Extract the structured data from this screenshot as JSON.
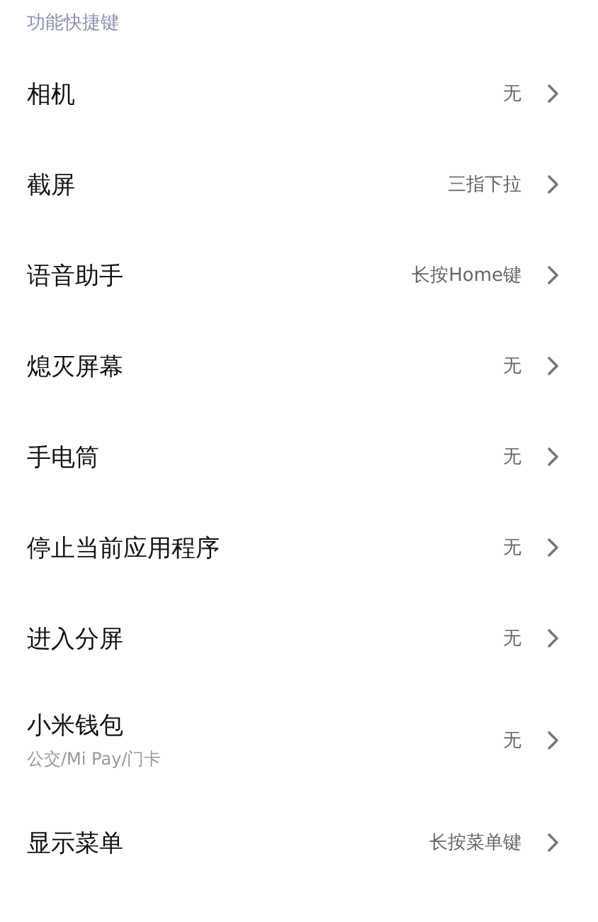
{
  "section_title": "功能快捷键",
  "items": [
    {
      "label": "相机",
      "value": "无"
    },
    {
      "label": "截屏",
      "value": "三指下拉"
    },
    {
      "label": "语音助手",
      "value": "长按Home键"
    },
    {
      "label": "熄灭屏幕",
      "value": "无"
    },
    {
      "label": "手电筒",
      "value": "无"
    },
    {
      "label": "停止当前应用程序",
      "value": "无"
    },
    {
      "label": "进入分屏",
      "value": "无"
    },
    {
      "label": "小米钱包",
      "subtitle": "公交/Mi Pay/门卡",
      "value": "无"
    },
    {
      "label": "显示菜单",
      "value": "长按菜单键"
    }
  ]
}
